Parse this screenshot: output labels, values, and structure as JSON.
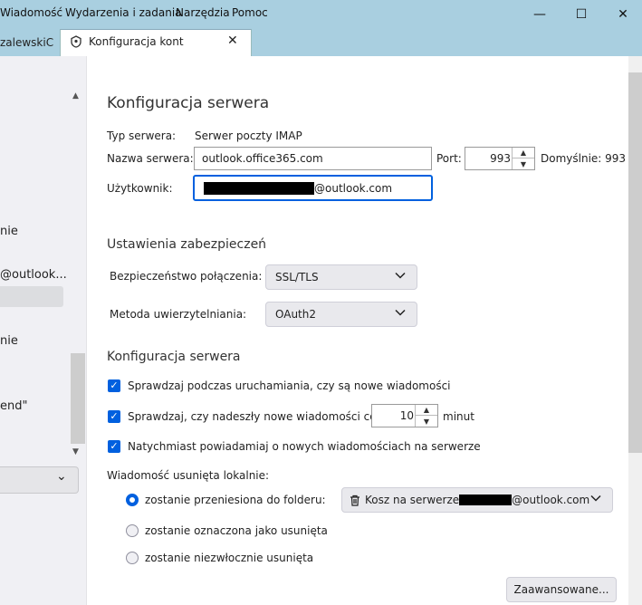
{
  "menubar": {
    "items": [
      "Wiadomość",
      "Wydarzenia i zadania",
      "Narzędzia",
      "Pomoc"
    ],
    "window_buttons": {
      "minimize": "—",
      "maximize": "☐",
      "close": "✕"
    }
  },
  "tabs": {
    "previous_label": "zalewskiC",
    "active_label": "Konfiguracja kont",
    "close_glyph": "✕"
  },
  "left_pane": {
    "items": [
      "nie",
      "@outlook...",
      "nie",
      "end\""
    ],
    "scroll_up": "▲",
    "scroll_down": "▼",
    "dropdown_chevron": "⌄"
  },
  "server_settings": {
    "title": "Konfiguracja serwera",
    "server_type_label": "Typ serwera:",
    "server_type_value": "Serwer poczty IMAP",
    "server_name_label": "Nazwa serwera:",
    "server_name_value": "outlook.office365.com",
    "port_label": "Port:",
    "port_value": "993",
    "default_label": "Domyślnie: 993",
    "user_label": "Użytkownik:",
    "user_value_suffix": "@outlook.com"
  },
  "security": {
    "title": "Ustawienia zabezpieczeń",
    "connection_label": "Bezpieczeństwo połączenia:",
    "connection_value": "SSL/TLS",
    "auth_label": "Metoda uwierzytelniania:",
    "auth_value": "OAuth2"
  },
  "server_config": {
    "title": "Konfiguracja serwera",
    "check_startup": "Sprawdzaj podczas uruchamiania, czy są nowe wiadomości",
    "check_every": "Sprawdzaj, czy nadeszły nowe wiadomości co",
    "check_every_value": "10",
    "minutes_label": "minut",
    "notify_immediately": "Natychmiast powiadamiaj o nowych wiadomościach na serwerze",
    "deleted_label": "Wiadomość usunięta lokalnie:",
    "opt_move": "zostanie przeniesiona do folderu:",
    "folder_prefix": "Kosz na serwerze",
    "folder_suffix": "@outlook.com",
    "opt_mark": "zostanie oznaczona jako usunięta",
    "opt_delete": "zostanie niezwłocznie usunięta",
    "advanced_button": "Zaawansowane..."
  }
}
